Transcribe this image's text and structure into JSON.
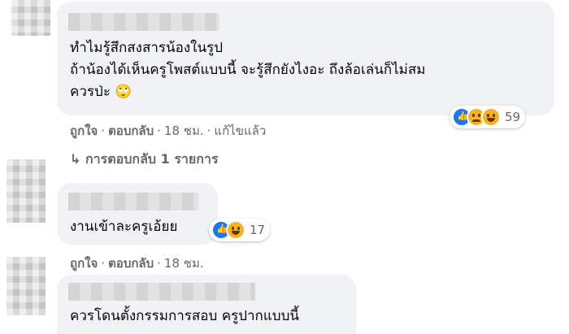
{
  "comments": [
    {
      "lines": [
        "ทำไมรู้สึกสงสารน้องในรูป",
        "ถ้าน้องได้เห็นครูโพสต์แบบนี้ จะรู้สึกยังไงอะ ถึงล้อเล่นก็ไม่สม",
        "ควรป่ะ 🙄"
      ],
      "actions": {
        "like": "ถูกใจ",
        "reply": "ตอบกลับ",
        "time": "18 ชม.",
        "edited": "แก้ไขแล้ว"
      },
      "reactions": {
        "types": [
          "like",
          "sad",
          "haha"
        ],
        "count": "59"
      },
      "replies_link": "↳ การตอบกลับ 1 รายการ"
    },
    {
      "lines": [
        "งานเข้าละครูเอ้ยย"
      ],
      "actions": {
        "like": "ถูกใจ",
        "reply": "ตอบกลับ",
        "time": "18 ชม."
      },
      "reactions": {
        "types": [
          "like",
          "haha"
        ],
        "count": "17"
      }
    },
    {
      "lines": [
        "ควรโดนตั้งกรรมการสอบ ครูปากแบบนี้"
      ]
    }
  ]
}
